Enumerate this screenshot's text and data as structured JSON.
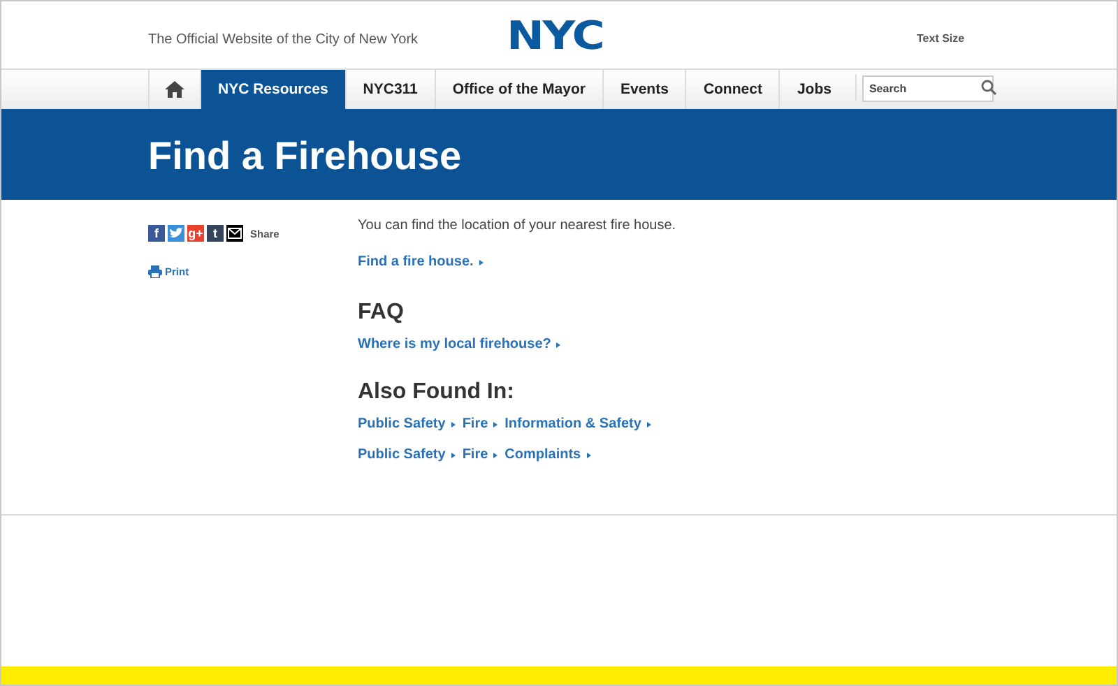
{
  "header": {
    "tagline": "The Official Website of the City of New York",
    "logo": "NYC",
    "text_size": "Text Size"
  },
  "nav": {
    "tabs": [
      {
        "label": "NYC Resources",
        "selected": true
      },
      {
        "label": "NYC311",
        "selected": false
      },
      {
        "label": "Office of the Mayor",
        "selected": false
      },
      {
        "label": "Events",
        "selected": false
      },
      {
        "label": "Connect",
        "selected": false
      },
      {
        "label": "Jobs",
        "selected": false
      }
    ],
    "search": {
      "placeholder": "Search"
    }
  },
  "banner": {
    "title": "Find a Firehouse"
  },
  "share": {
    "buttons": [
      {
        "kind": "glyph",
        "glyph": "f",
        "color": "#3b5998"
      },
      {
        "kind": "bird",
        "color": "#3b8fd6"
      },
      {
        "kind": "glyph",
        "glyph": "g+",
        "color": "#e9412e"
      },
      {
        "kind": "glyph",
        "glyph": "t",
        "color": "#35465c"
      },
      {
        "kind": "mail",
        "color": "#000000"
      }
    ],
    "label": "Share",
    "print": "Print"
  },
  "content": {
    "intro": "You can find the location of your nearest fire house.",
    "link": "Find a fire house.",
    "faq_heading": "FAQ",
    "faq_links": [
      "Where is my local firehouse?"
    ],
    "also_heading": "Also Found In:",
    "breadcrumbs": [
      [
        "Public Safety",
        "Fire",
        "Information & Safety"
      ],
      [
        "Public Safety",
        "Fire",
        "Complaints"
      ]
    ]
  }
}
